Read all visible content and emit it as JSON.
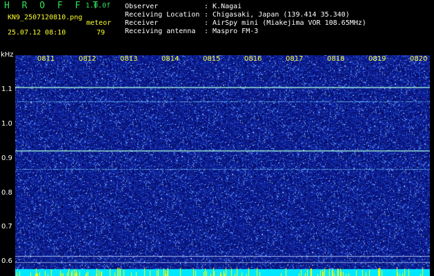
{
  "header": {
    "app_title": "H R O F F T",
    "version": "1.0.0f",
    "filename": "KN9_2507120810.png",
    "mode": "meteor",
    "datetime": "25.07.12 08:10",
    "count": "79"
  },
  "info": {
    "observer_label": "Observer",
    "observer_value": ": K.Nagai",
    "location_label": "Receiving Location",
    "location_value": ": Chigasaki, Japan (139.414 35.340)",
    "receiver_label": "Receiver",
    "receiver_value": ": AirSpy mini (Miakejima VOR 108.65MHz)",
    "antenna_label": "Receiving antenna",
    "antenna_value": ": Maspro FM-3"
  },
  "axis": {
    "y_unit": "kHz",
    "y_ticks": [
      "1.1",
      "1.0",
      "0.9",
      "0.8",
      "0.7",
      "0.6"
    ],
    "x_ticks": [
      "0811",
      "0812",
      "0813",
      "0814",
      "0815",
      "0816",
      "0817",
      "0818",
      "0819",
      "0820"
    ]
  },
  "colors": {
    "background": "#000000",
    "spectrum_base": "#0a1a8c",
    "noise_light": "#4a8cff",
    "signal_line": "#9ff0d8",
    "bottom_bar": "#00e8ff",
    "bottom_spikes": "#ffff00"
  }
}
